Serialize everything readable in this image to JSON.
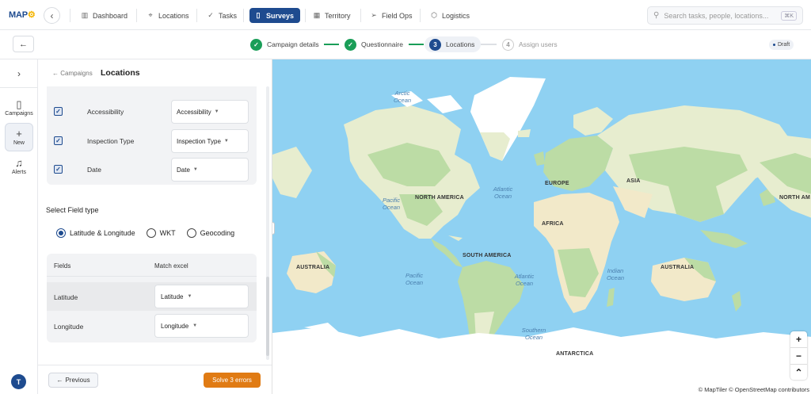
{
  "brand": {
    "logo_text_a": "MAP",
    "logo_text_b": "⚙"
  },
  "nav": {
    "items": [
      {
        "label": "Dashboard",
        "icon": "bar-chart-icon"
      },
      {
        "label": "Locations",
        "icon": "pin-icon"
      },
      {
        "label": "Tasks",
        "icon": "check-icon"
      },
      {
        "label": "Surveys",
        "icon": "clipboard-icon",
        "active": true
      },
      {
        "label": "Territory",
        "icon": "map-icon"
      },
      {
        "label": "Field Ops",
        "icon": "send-icon"
      },
      {
        "label": "Logistics",
        "icon": "box-icon"
      }
    ],
    "search_placeholder": "Search tasks, people, locations...",
    "search_shortcut": "⌘K"
  },
  "stepper": {
    "steps": [
      {
        "num": "✓",
        "label": "Campaign details",
        "state": "done"
      },
      {
        "num": "✓",
        "label": "Questionnaire",
        "state": "done"
      },
      {
        "num": "3",
        "label": "Locations",
        "state": "current"
      },
      {
        "num": "4",
        "label": "Assign users",
        "state": "pending"
      }
    ],
    "status_badge": "Draft"
  },
  "rail": {
    "items": [
      {
        "label": "Campaigns",
        "icon": "clipboard-icon"
      },
      {
        "label": "New",
        "icon": "plus-icon"
      },
      {
        "label": "Alerts",
        "icon": "bell-icon"
      }
    ],
    "avatar_initial": "T"
  },
  "panel": {
    "breadcrumb": "← Campaigns",
    "title": "Locations",
    "field_rows": [
      {
        "label": "Accessibility",
        "value": "Accessibility",
        "checked": true
      },
      {
        "label": "Inspection Type",
        "value": "Inspection Type",
        "checked": true
      },
      {
        "label": "Date",
        "value": "Date",
        "checked": true
      }
    ],
    "field_type_title": "Select Field type",
    "field_type_options": [
      {
        "label": "Latitude & Longitude",
        "selected": true
      },
      {
        "label": "WKT",
        "selected": false
      },
      {
        "label": "Geocoding",
        "selected": false
      }
    ],
    "mapping_headers": {
      "fields": "Fields",
      "match": "Match excel"
    },
    "mapping_rows": [
      {
        "field": "Latitude",
        "match": "Latitude"
      },
      {
        "field": "Longitude",
        "match": "Longitude"
      }
    ],
    "previous_label": "Previous",
    "errors_label": "Solve 3 errors"
  },
  "map": {
    "labels": {
      "north_america": "NORTH AMERICA",
      "north_america_right": "NORTH AM",
      "south_america": "SOUTH AMERICA",
      "europe": "EUROPE",
      "asia": "ASIA",
      "africa": "AFRICA",
      "australia_left": "AUSTRALIA",
      "australia_right": "AUSTRALIA",
      "antarctica": "ANTARCTICA",
      "arctic_ocean": "Arctic Ocean",
      "pacific_ocean_n": "Pacific Ocean",
      "atlantic_ocean_n": "Atlantic Ocean",
      "pacific_ocean_s": "Pacific Ocean",
      "atlantic_ocean_s": "Atlantic Ocean",
      "indian_ocean": "Indian Ocean",
      "southern_ocean": "Southern Ocean"
    },
    "zoom_in": "+",
    "zoom_out": "−",
    "compass": "⌃",
    "attribution": "© MapTiler © OpenStreetMap contributors",
    "colors": {
      "water": "#8fd1f2",
      "land": "#e7edcf",
      "forest": "#bcdca5",
      "desert": "#f2e9c9",
      "ice": "#ffffff"
    }
  }
}
